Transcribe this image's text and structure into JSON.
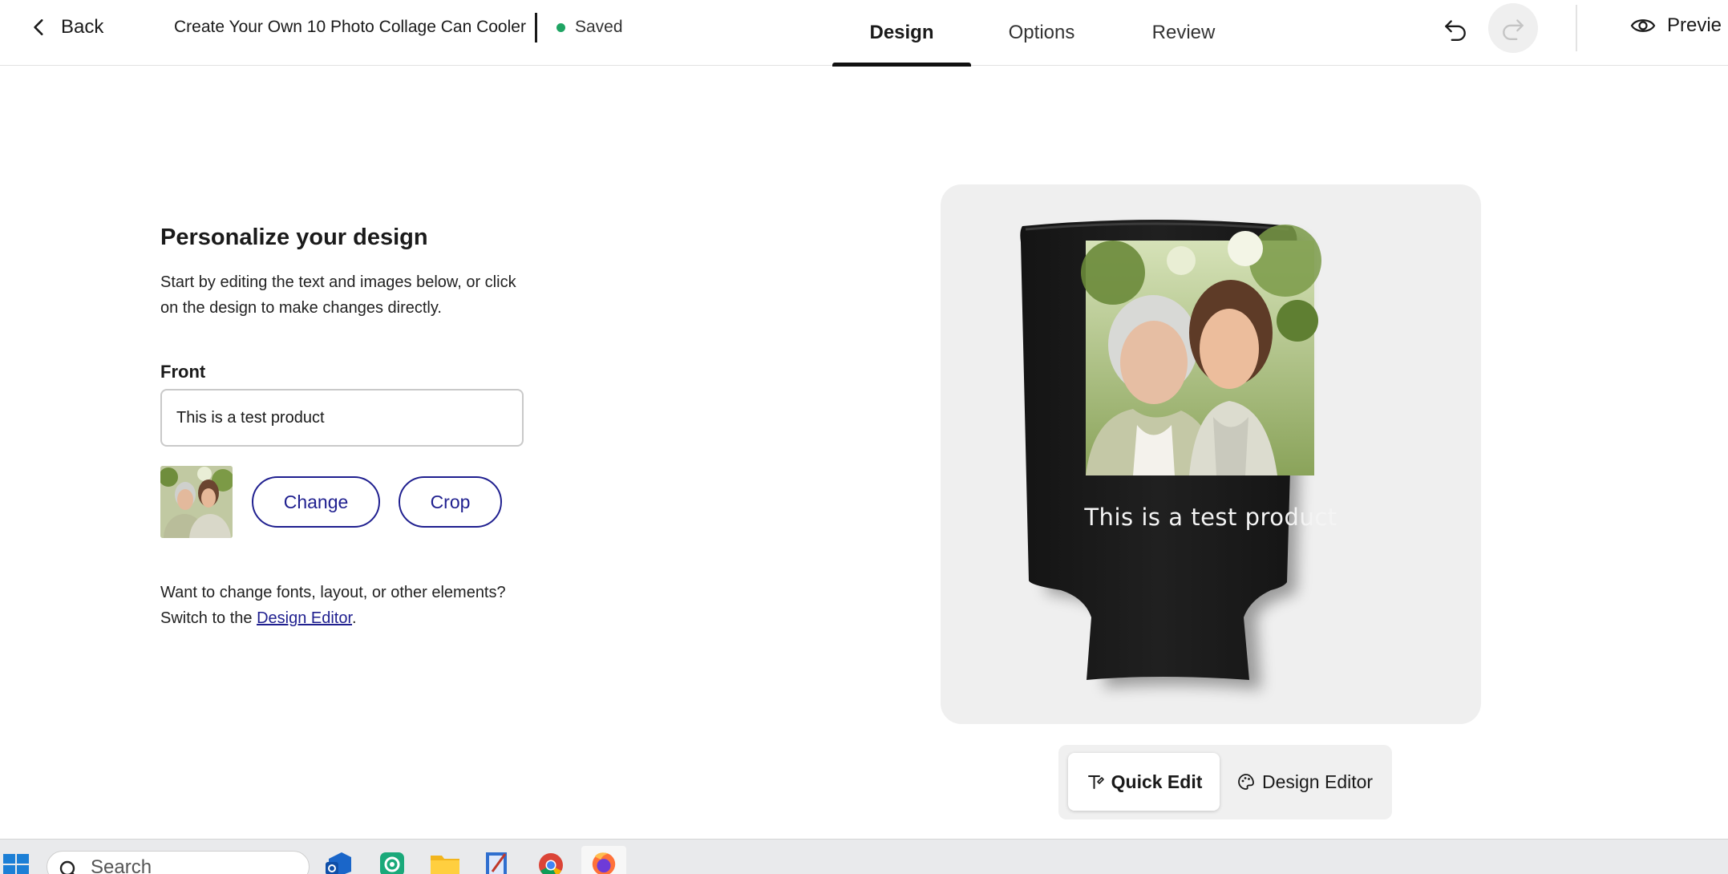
{
  "header": {
    "back_label": "Back",
    "title": "Create Your Own 10 Photo Collage Can Cooler",
    "save_status": "Saved",
    "preview_label": "Previe",
    "tabs": [
      {
        "label": "Design",
        "active": true
      },
      {
        "label": "Options",
        "active": false
      },
      {
        "label": "Review",
        "active": false
      }
    ],
    "icons": {
      "back": "chevron-left-icon",
      "undo": "undo-icon",
      "redo": "redo-icon",
      "preview": "eye-icon"
    }
  },
  "panel": {
    "heading": "Personalize your design",
    "intro": "Start by editing the text and images below, or click on the design to make changes directly.",
    "front_label": "Front",
    "front_text_value": "This is a test product",
    "change_label": "Change",
    "crop_label": "Crop",
    "help_line1": "Want to change fonts, layout, or other elements?",
    "help_prefix": "Switch to the ",
    "help_link": "Design Editor",
    "help_suffix": "."
  },
  "canvas": {
    "product_text": "This is a test product"
  },
  "mode_switch": {
    "quick_edit": "Quick Edit",
    "design_editor": "Design Editor",
    "icons": {
      "quick_edit": "text-edit-icon",
      "design_editor": "palette-icon"
    }
  },
  "taskbar": {
    "search_placeholder": "Search",
    "apps": [
      "windows-start-icon",
      "outlook-icon",
      "app-icon",
      "file-explorer-icon",
      "notepad-icon",
      "chrome-icon",
      "firefox-icon"
    ]
  },
  "colors": {
    "accent": "#1f1f8f",
    "saved_dot": "#1fa463",
    "cooler": "#1c1c1c",
    "canvas_bg": "#efefef"
  }
}
